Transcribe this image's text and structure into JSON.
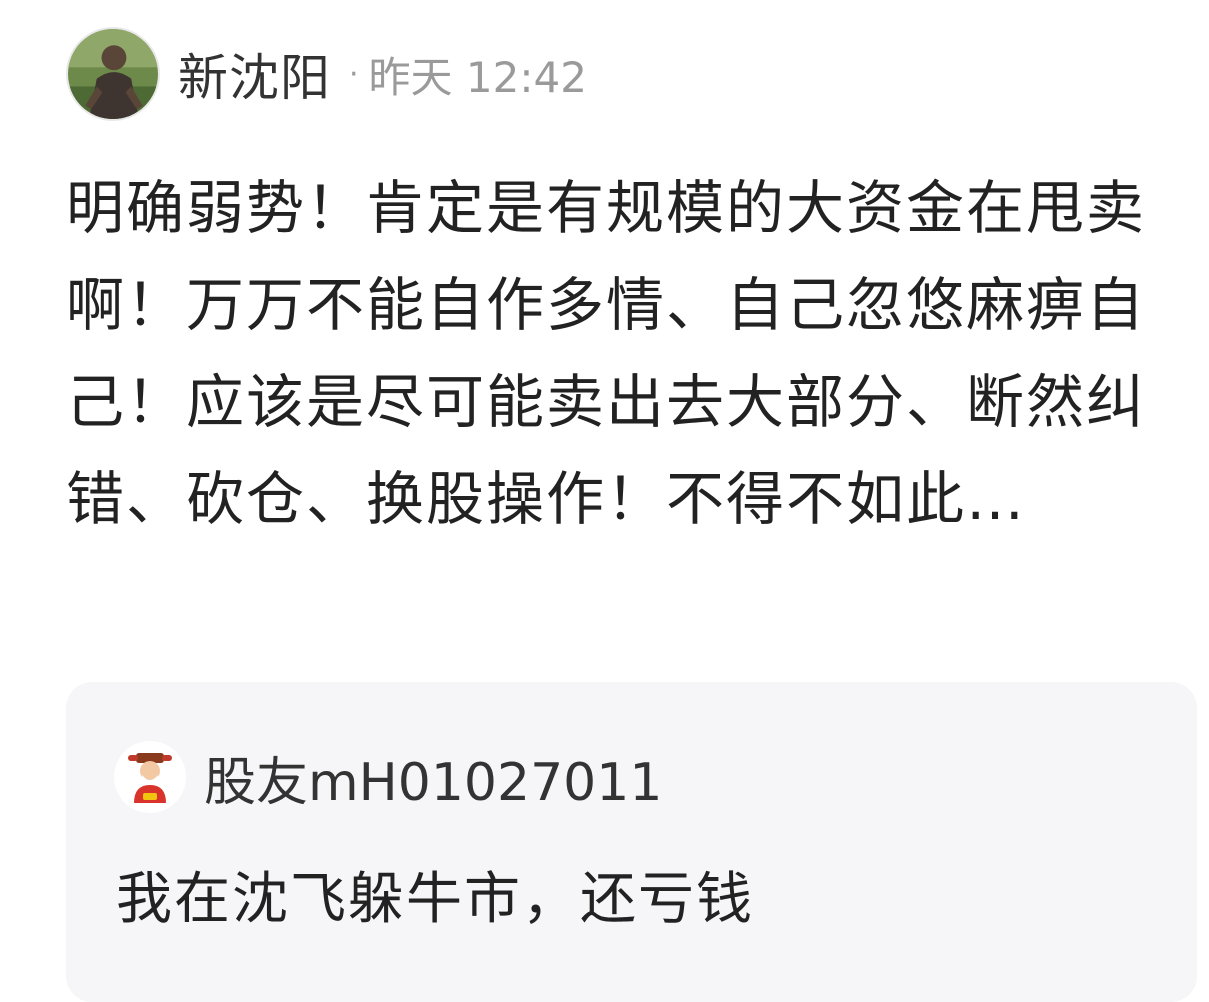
{
  "post": {
    "author": "新沈阳",
    "separator": "·",
    "time": "昨天 12:42",
    "avatar_icon": "user-avatar-photo",
    "body": "明确弱势！肯定是有规模的大资金在甩卖啊！万万不能自作多情、自己忽悠麻痹自己！应该是尽可能卖出去大部分、断然纠错、砍仓、换股操作！不得不如此…"
  },
  "quoted_comment": {
    "author": "股友mH01027011",
    "avatar_icon": "fortune-god-avatar-icon",
    "text": "我在沈飞躲牛市，还亏钱"
  },
  "colors": {
    "background": "#ffffff",
    "text_primary": "#222222",
    "text_secondary": "#9a9a9a",
    "quote_background": "#f6f6f8"
  }
}
